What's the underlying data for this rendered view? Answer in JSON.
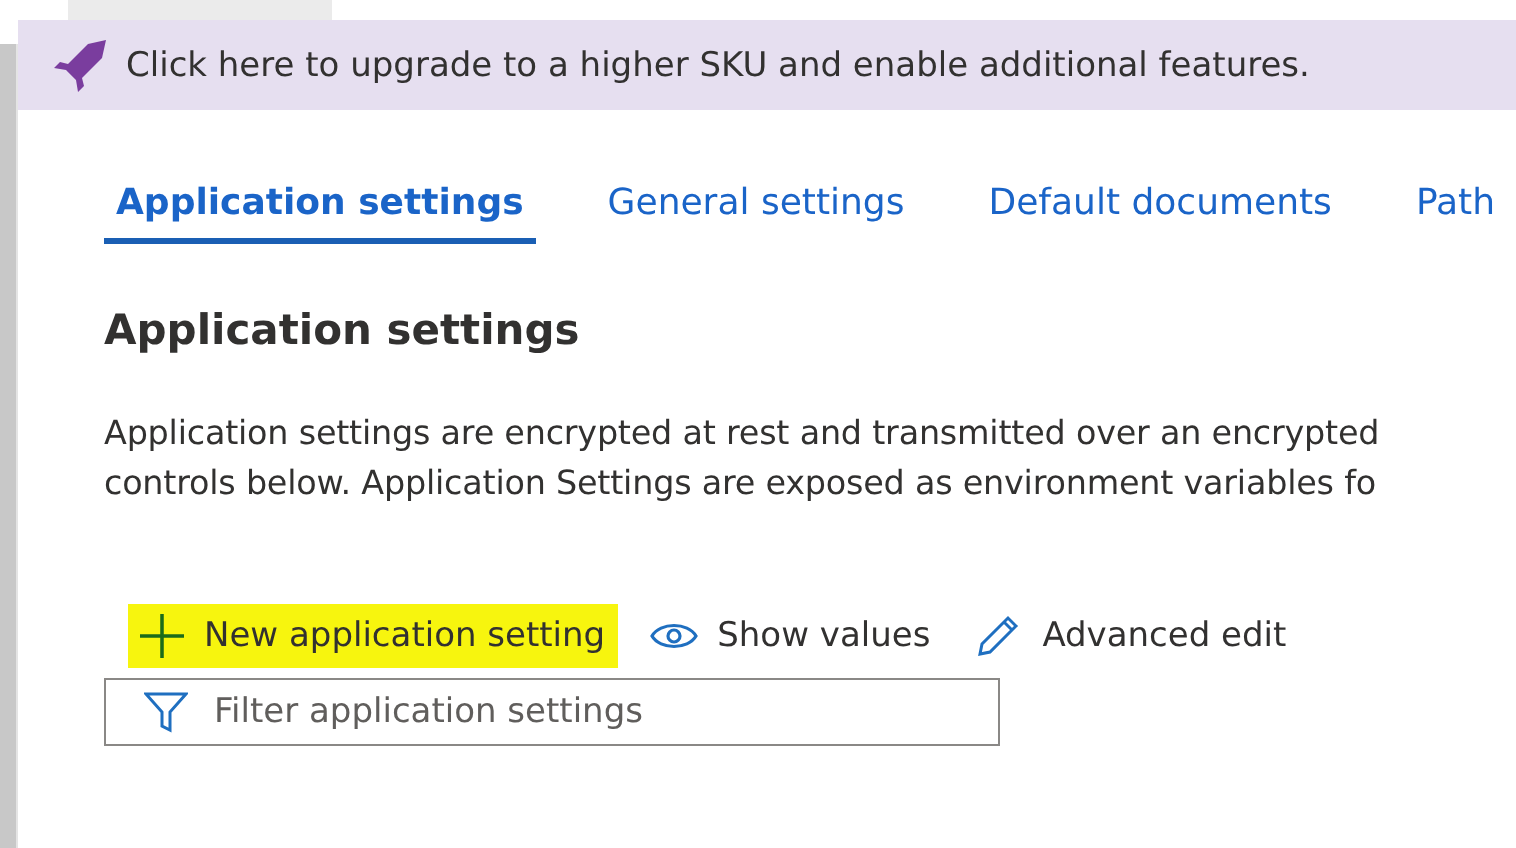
{
  "banner": {
    "text": "Click here to upgrade to a higher SKU and enable additional features."
  },
  "tabs": [
    {
      "label": "Application settings",
      "selected": true
    },
    {
      "label": "General settings",
      "selected": false
    },
    {
      "label": "Default documents",
      "selected": false
    },
    {
      "label": "Path",
      "selected": false
    }
  ],
  "heading": "Application settings",
  "description": [
    "Application settings are encrypted at rest and transmitted over an encrypted",
    "controls below. Application Settings are exposed as environment variables fo"
  ],
  "commands": [
    {
      "kind": "add",
      "label": "New application setting",
      "highlighted": true
    },
    {
      "kind": "show",
      "label": "Show values",
      "highlighted": false
    },
    {
      "kind": "edit",
      "label": "Advanced edit",
      "highlighted": false
    }
  ],
  "filter": {
    "placeholder": "Filter application settings"
  }
}
